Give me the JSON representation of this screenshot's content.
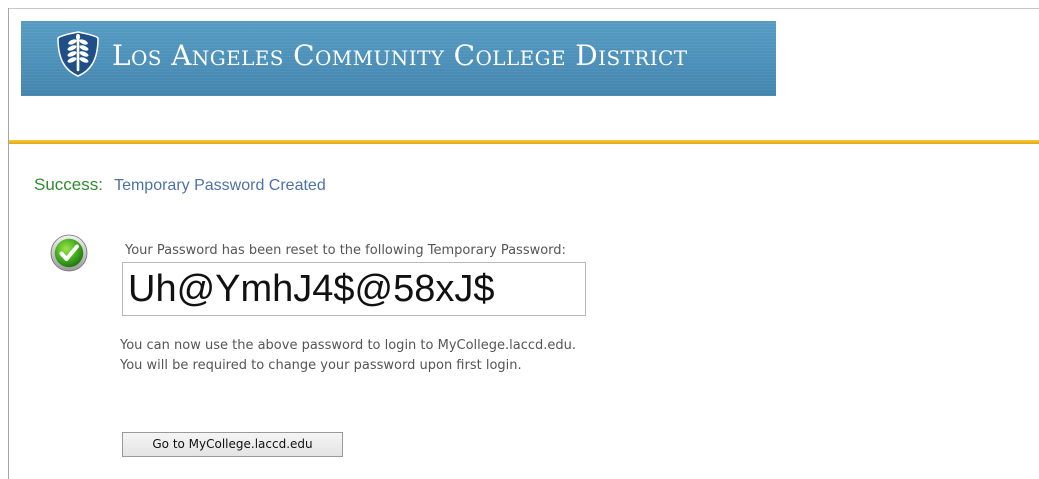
{
  "header": {
    "title": "Los Angeles Community College District",
    "logo_icon": "wheat-shield-icon",
    "banner_color": "#4d92bb",
    "accent_rule_color": "#efb72a"
  },
  "status": {
    "label": "Success:",
    "message": "Temporary Password Created",
    "label_color": "#2e8b2e",
    "message_color": "#4d72a8"
  },
  "result": {
    "icon": "checkmark-icon",
    "reset_text": "Your Password has been reset to the following Temporary Password:",
    "temporary_password": "Uh@YmhJ4$@58xJ$",
    "instruction_line1": "You can now use the above password to login to MyCollege.laccd.edu.",
    "instruction_line2": "You will be required to change your password upon first login."
  },
  "actions": {
    "go_button_label": "Go to MyCollege.laccd.edu"
  }
}
